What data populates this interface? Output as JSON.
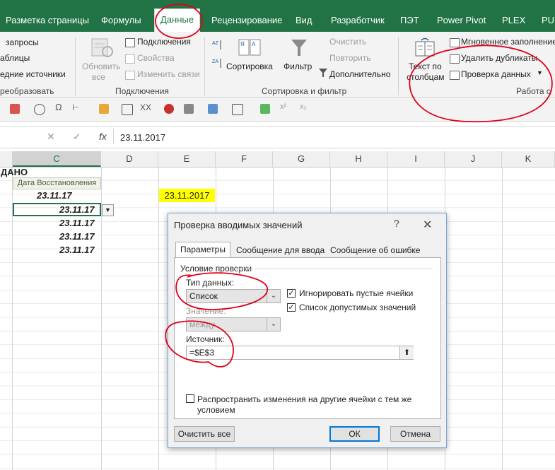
{
  "ribbon_tabs": [
    "Разметка страницы",
    "Формулы",
    "Данные",
    "Рецензирование",
    "Вид",
    "Разработчик",
    "ПЭТ",
    "Power Pivot",
    "PLEX",
    "PUF"
  ],
  "get_transform": {
    "queries": "запросы",
    "tables": "аблицы",
    "recent": "едние источники",
    "group": "реобразовать"
  },
  "connections": {
    "refresh_all_l1": "Обновить",
    "refresh_all_l2": "все",
    "connections": "Подключения",
    "properties": "Свойства",
    "edit_links": "Изменить связи",
    "group": "Подключения"
  },
  "sort_filter": {
    "sort": "Сортировка",
    "filter": "Фильтр",
    "clear": "Очистить",
    "reapply": "Повторить",
    "advanced": "Дополнительно",
    "group": "Сортировка и фильтр"
  },
  "data_tools": {
    "text_to_cols_l1": "Текст по",
    "text_to_cols_l2": "столбцам",
    "flash_fill": "Мгновенное заполнение",
    "remove_dupes": "Удалить дубликаты",
    "validation": "Проверка данных",
    "group": "Работа с"
  },
  "formula_bar": {
    "cancel": "✕",
    "enter": "✓",
    "fx": "fx",
    "value": "23.11.2017"
  },
  "columns": [
    "C",
    "D",
    "E",
    "F",
    "G",
    "H",
    "I",
    "J",
    "K"
  ],
  "sheet": {
    "b1": "ДАНО",
    "c2": "Дата Восстановления",
    "c3": "23.11.17",
    "c4": "23.11.17",
    "c5": "23.11.17",
    "c6": "23.11.17",
    "c7": "23.11.17",
    "e3": "23.11.2017"
  },
  "dialog": {
    "title": "Проверка вводимых значений",
    "help": "?",
    "close": "✕",
    "tabs": [
      "Параметры",
      "Сообщение для ввода",
      "Сообщение об ошибке"
    ],
    "criteria_group": "Условие проверки",
    "allow_label": "Тип данных:",
    "allow_value": "Список",
    "ignore_blank": "Игнорировать пустые ячейки",
    "in_cell_dropdown": "Список допустимых значений",
    "data_label": "Значение:",
    "data_value": "между",
    "source_label": "Источник:",
    "source_value": "=$E$3",
    "apply_all_l1": "Распространить изменения на другие ячейки с тем же",
    "apply_all_l2": "условием",
    "clear_all": "Очистить все",
    "ok": "ОК",
    "cancel": "Отмена"
  },
  "colors": {
    "excel_green": "#217346",
    "highlight_yellow": "#ffff00",
    "annotation_red": "#e0001b",
    "dialog_accent": "#0078d7"
  }
}
